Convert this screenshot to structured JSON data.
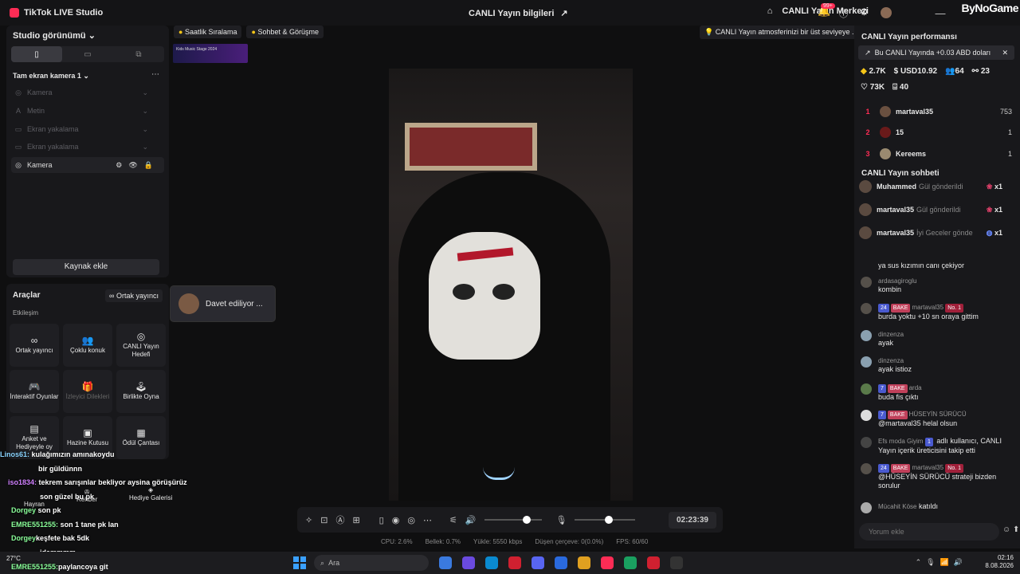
{
  "titlebar": {
    "app": "TikTok LIVE Studio",
    "center": "CANLI Yayın bilgileri",
    "center2": "CANLI Yayın Merkezi",
    "notif": "99+",
    "brand": "ByNoGame"
  },
  "left": {
    "title": "Studio görünümü",
    "scene": "Tam ekran kamera 1",
    "sources": [
      {
        "label": "Kamera",
        "active": false
      },
      {
        "label": "Metin",
        "active": false
      },
      {
        "label": "Ekran yakalama",
        "active": false
      },
      {
        "label": "Ekran yakalama",
        "active": false
      },
      {
        "label": "Kamera",
        "active": true
      }
    ],
    "add_source": "Kaynak ekle"
  },
  "tools": {
    "title": "Araçlar",
    "co_host": "Ortak yayıncı",
    "section": "Etkileşim",
    "tiles": [
      "Ortak yayıncı",
      "Çoklu konuk",
      "CANLI Yayın Hedefi",
      "İnteraktif Oyunlar",
      "İzleyici Dilekleri",
      "Birlikte Oyna",
      "Anket ve Hediyeyle oy",
      "Hazine Kutusu",
      "Ödül Çantası",
      "Hayran",
      "Rehber",
      "Hediye Galerisi"
    ]
  },
  "invite": "Davet ediliyor ...",
  "chips": [
    "Saatlik Sıralama",
    "Sohbet & Görüşme"
  ],
  "hint": "CANLI Yayın atmosferinizi bir üst seviyeye ...",
  "banner": "Kids Music Stage 2024",
  "controls": {
    "timer": "02:23:39"
  },
  "stats": {
    "cpu": "CPU: 2.6%",
    "mem": "Bellek: 0.7%",
    "upload": "Yükle: 5550 kbps",
    "drop": "Düşen çerçeve: 0(0.0%)",
    "fps": "FPS: 60/60"
  },
  "perf": {
    "title": "CANLI Yayın performansı",
    "earn": "Bu CANLI Yayında +0.03 ABD doları",
    "k1": "2.7K",
    "k2": "USD10.92",
    "k3": "64",
    "k4": "23",
    "k5": "73K",
    "k6": "40"
  },
  "ranking": [
    {
      "n": "1",
      "name": "martaval35",
      "score": "753"
    },
    {
      "n": "2",
      "name": "15",
      "score": "1"
    },
    {
      "n": "3",
      "name": "Kereems",
      "score": "1"
    }
  ],
  "chat": {
    "title": "CANLI Yayın sohbeti",
    "gifts": [
      {
        "user": "Muhammed",
        "msg": "Gül gönderildi",
        "count": "x1"
      },
      {
        "user": "martaval35",
        "msg": "Gül gönderildi",
        "count": "x1"
      },
      {
        "user": "martaval35",
        "msg": "İyi Geceler gönde",
        "count": "x1"
      }
    ],
    "messages": [
      {
        "name": "",
        "badges": [],
        "text": "ya sus kızımın canı çekiyor"
      },
      {
        "name": "ardasagiroglu",
        "badges": [],
        "text": "kombin"
      },
      {
        "name": "martaval35",
        "badges": [
          "24",
          "BAKE",
          "No. 1"
        ],
        "text": "burda yoktu +10 sn oraya gittim"
      },
      {
        "name": "dinzenza",
        "badges": [],
        "text": "ayak"
      },
      {
        "name": "dinzenza",
        "badges": [],
        "text": "ayak istioz"
      },
      {
        "name": "arda",
        "badges": [
          "7",
          "BAKE"
        ],
        "text": "buda fis çıktı"
      },
      {
        "name": "HÜSEYİN SÜRÜCÜ",
        "badges": [
          "7",
          "BAKE"
        ],
        "text": "@martaval35 helal olsun"
      },
      {
        "name": "Efs moda Giyim",
        "badges": [
          "1"
        ],
        "text": "adlı kullanıcı, CANLI Yayın içerik üreticisini takip etti"
      },
      {
        "name": "martaval35",
        "badges": [
          "24",
          "BAKE",
          "No. 1"
        ],
        "text": "@HÜSEYİN SÜRÜCÜ strateji bizden sorulur"
      },
      {
        "name": "Mücahit Köse",
        "badges": [],
        "text": "katıldı"
      }
    ],
    "reply": "Yorum ekle"
  },
  "overlay": [
    {
      "u": "Linos61:",
      "t": "kulağımızın amınakoydu"
    },
    {
      "u": "",
      "t": "bir güldünnn"
    },
    {
      "u": "iso1834:",
      "t": "tekrem sarışınlar bekliyor aysina görüşürüz"
    },
    {
      "u": "",
      "t": "son güzel bu pk"
    },
    {
      "u": "Dorgey",
      "t": "son pk"
    },
    {
      "u": "EMRE551255:",
      "t": "son 1 tane pk lan"
    },
    {
      "u": "Dorgey",
      "t": "keşfete bak 5dk"
    },
    {
      "u": "",
      "t": "idammmm"
    },
    {
      "u": "EMRE551255:",
      "t": "paylancoya git"
    }
  ],
  "taskbar": {
    "search": "Ara",
    "time": "02:16",
    "date": "8.08.2026",
    "weather": "27°C"
  }
}
